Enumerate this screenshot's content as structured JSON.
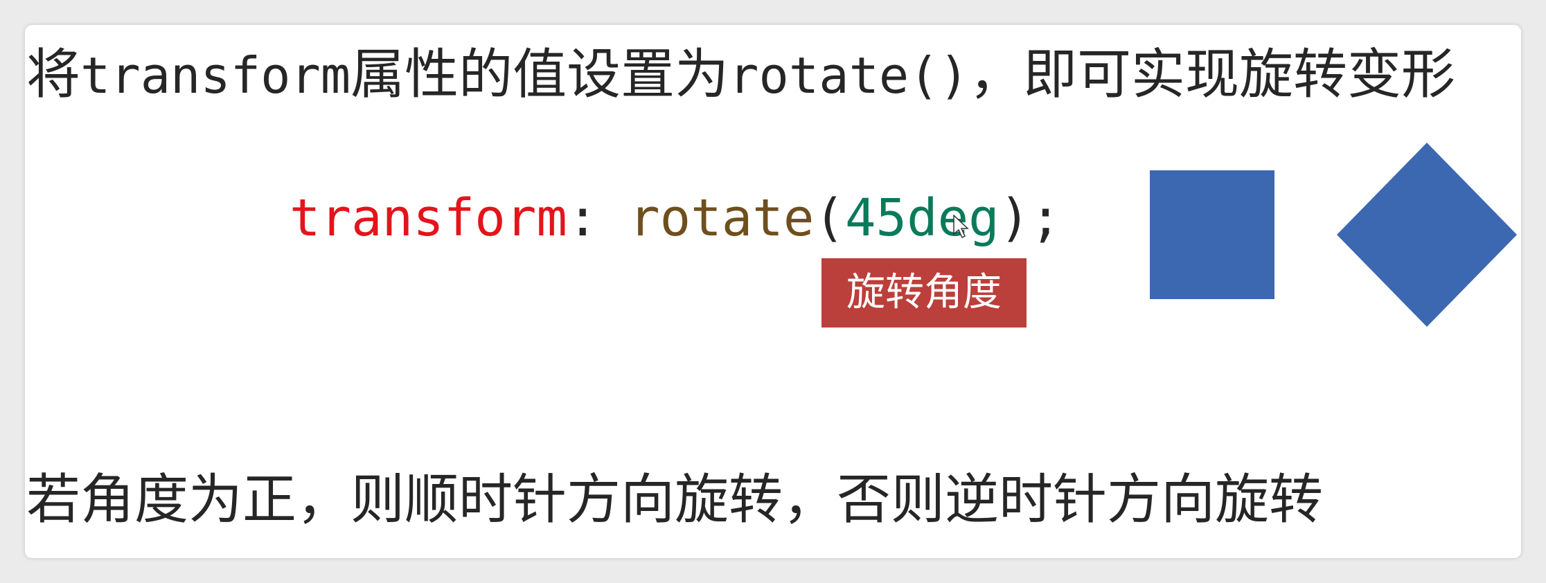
{
  "title": {
    "pre": "将",
    "code": "transform",
    "mid": "属性的值设置为",
    "code2": "rotate()",
    "post": "，即可实现旋转变形"
  },
  "code": {
    "property": "transform",
    "colon": ":",
    "function": "rotate",
    "open_paren": "(",
    "value": "45deg",
    "close": ");"
  },
  "annotation": {
    "label": "旋转角度"
  },
  "footer": {
    "text": "若角度为正，则顺时针方向旋转，否则逆时针方向旋转"
  },
  "shapes": {
    "color": "#3c68b2",
    "rotated_angle_deg": 45
  },
  "colors": {
    "property": "#e3141b",
    "function": "#6e4f1d",
    "value": "#0a7a5a",
    "label_bg": "#bb3f3a"
  }
}
